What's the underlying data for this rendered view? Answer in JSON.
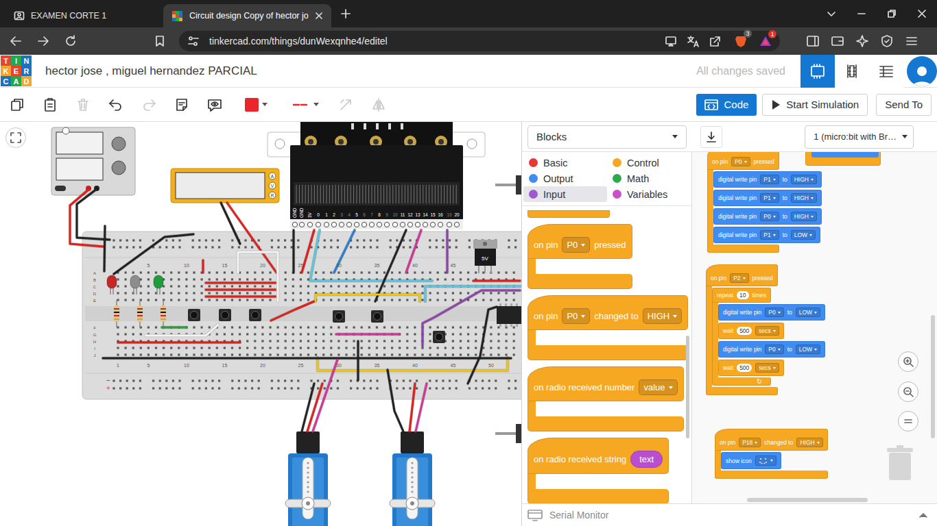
{
  "browser": {
    "tabs": [
      {
        "label": "EXAMEN CORTE 1",
        "selected": false
      },
      {
        "label": "Circuit design Copy of hector jo",
        "selected": true
      }
    ],
    "url": "tinkercad.com/things/dunWexqnhe4/editel",
    "badges": [
      "3",
      "1"
    ]
  },
  "app": {
    "logo": [
      {
        "letter": "T",
        "color": "#e8442c"
      },
      {
        "letter": "I",
        "color": "#1eaa4f"
      },
      {
        "letter": "N",
        "color": "#1b72c0"
      },
      {
        "letter": "K",
        "color": "#f0a72a"
      },
      {
        "letter": "E",
        "color": "#e8442c"
      },
      {
        "letter": "R",
        "color": "#1b72c0"
      },
      {
        "letter": "C",
        "color": "#1b72c0"
      },
      {
        "letter": "A",
        "color": "#1eaa4f"
      },
      {
        "letter": "D",
        "color": "#f0a72a"
      }
    ],
    "title": "hector jose , miguel hernandez PARCIAL",
    "save_status": "All changes saved",
    "views": [
      {
        "kind": "circuit",
        "selected": true
      },
      {
        "kind": "schematic",
        "selected": false
      },
      {
        "kind": "list",
        "selected": false
      }
    ]
  },
  "toolbar": {
    "tools": [
      {
        "kind": "copy",
        "disabled": false
      },
      {
        "kind": "paste",
        "disabled": false
      },
      {
        "kind": "delete",
        "disabled": true
      },
      {
        "kind": "undo",
        "disabled": false
      },
      {
        "kind": "redo",
        "disabled": true
      },
      {
        "kind": "note",
        "disabled": false
      },
      {
        "kind": "notes-visibility",
        "disabled": false
      },
      {
        "kind": "fill-color",
        "disabled": false,
        "color": "#e8262b"
      },
      {
        "kind": "line-style",
        "disabled": false,
        "color": "#e8262b"
      },
      {
        "kind": "rotate",
        "disabled": true
      },
      {
        "kind": "mirror",
        "disabled": true
      }
    ],
    "code_button": {
      "label": "Code",
      "selected": true
    },
    "simulate": "Start Simulation",
    "send_to": "Send To"
  },
  "code": {
    "editor_mode": "Blocks",
    "device": "1 (micro:bit with Br…",
    "categories": [
      {
        "label": "Basic",
        "color": "#e53935",
        "selected": false
      },
      {
        "label": "Control",
        "color": "#f5a623",
        "selected": false
      },
      {
        "label": "Output",
        "color": "#3f8df3",
        "selected": false
      },
      {
        "label": "Math",
        "color": "#2faa4a",
        "selected": false
      },
      {
        "label": "Input",
        "color": "#9a5cd0",
        "selected": true
      },
      {
        "label": "Variables",
        "color": "#c94fc8",
        "selected": false
      }
    ],
    "palette": [
      {
        "kind": "fragment",
        "color": "#f7a823"
      },
      {
        "kind": "hat",
        "color": "#f7a823",
        "parts": [
          {
            "kind": "label",
            "text": "on pin"
          },
          {
            "kind": "dropdown",
            "text": "P0"
          },
          {
            "kind": "label",
            "text": "pressed"
          }
        ],
        "body": []
      },
      {
        "kind": "hat",
        "color": "#f7a823",
        "parts": [
          {
            "kind": "label",
            "text": "on pin"
          },
          {
            "kind": "dropdown",
            "text": "P0"
          },
          {
            "kind": "label",
            "text": "changed to"
          },
          {
            "kind": "dropdown",
            "text": "HIGH"
          }
        ],
        "body": []
      },
      {
        "kind": "hat",
        "color": "#f7a823",
        "parts": [
          {
            "kind": "label",
            "text": "on radio received number"
          },
          {
            "kind": "dropdown",
            "text": "value"
          }
        ],
        "body": []
      },
      {
        "kind": "hat",
        "color": "#f7a823",
        "parts": [
          {
            "kind": "label",
            "text": "on radio received string"
          },
          {
            "kind": "reporter",
            "text": "text",
            "color": "#b94fd0"
          }
        ],
        "body": []
      },
      {
        "kind": "fragment",
        "color": "#f7a823"
      }
    ],
    "scripts": [
      {
        "kind": "hat",
        "color": "#f7a823",
        "parts": [
          {
            "kind": "label",
            "text": "on pin"
          },
          {
            "kind": "dropdown",
            "text": "P0"
          },
          {
            "kind": "label",
            "text": "pressed"
          }
        ],
        "body": [
          {
            "kind": "statement",
            "color": "#3f8df3",
            "parts": [
              {
                "kind": "label",
                "text": "digital write pin"
              },
              {
                "kind": "dropdown",
                "text": "P1"
              },
              {
                "kind": "label",
                "text": "to"
              },
              {
                "kind": "dropdown",
                "text": "HIGH"
              }
            ]
          },
          {
            "kind": "statement",
            "color": "#3f8df3",
            "parts": [
              {
                "kind": "label",
                "text": "digital write pin"
              },
              {
                "kind": "dropdown",
                "text": "P1"
              },
              {
                "kind": "label",
                "text": "to"
              },
              {
                "kind": "dropdown",
                "text": "HIGH"
              }
            ]
          },
          {
            "kind": "statement",
            "color": "#3f8df3",
            "parts": [
              {
                "kind": "label",
                "text": "digital write pin"
              },
              {
                "kind": "dropdown",
                "text": "P0"
              },
              {
                "kind": "label",
                "text": "to"
              },
              {
                "kind": "dropdown",
                "text": "HIGH"
              }
            ]
          },
          {
            "kind": "statement",
            "color": "#3f8df3",
            "parts": [
              {
                "kind": "label",
                "text": "digital write pin"
              },
              {
                "kind": "dropdown",
                "text": "P1"
              },
              {
                "kind": "label",
                "text": "to"
              },
              {
                "kind": "dropdown",
                "text": "LOW"
              }
            ]
          }
        ]
      },
      {
        "kind": "hat",
        "color": "#f7a823",
        "parts": [
          {
            "kind": "label",
            "text": "on pin"
          },
          {
            "kind": "dropdown",
            "text": "P2"
          },
          {
            "kind": "label",
            "text": "pressed"
          }
        ],
        "body": [
          {
            "kind": "loop",
            "color": "#f7a823",
            "parts": [
              {
                "kind": "label",
                "text": "repeat"
              },
              {
                "kind": "number",
                "text": "10"
              },
              {
                "kind": "label",
                "text": "times"
              }
            ],
            "footer": "↻",
            "body": [
              {
                "kind": "statement",
                "color": "#3f8df3",
                "parts": [
                  {
                    "kind": "label",
                    "text": "digital write pin"
                  },
                  {
                    "kind": "dropdown",
                    "text": "P0"
                  },
                  {
                    "kind": "label",
                    "text": "to"
                  },
                  {
                    "kind": "dropdown",
                    "text": "LOW"
                  }
                ]
              },
              {
                "kind": "statement",
                "color": "#f7a823",
                "parts": [
                  {
                    "kind": "label",
                    "text": "wait"
                  },
                  {
                    "kind": "number",
                    "text": "500"
                  },
                  {
                    "kind": "dropdown",
                    "text": "secs"
                  }
                ]
              },
              {
                "kind": "statement",
                "color": "#3f8df3",
                "parts": [
                  {
                    "kind": "label",
                    "text": "digital write pin"
                  },
                  {
                    "kind": "dropdown",
                    "text": "P0"
                  },
                  {
                    "kind": "label",
                    "text": "to"
                  },
                  {
                    "kind": "dropdown",
                    "text": "LOW"
                  }
                ]
              },
              {
                "kind": "statement",
                "color": "#f7a823",
                "parts": [
                  {
                    "kind": "label",
                    "text": "wait"
                  },
                  {
                    "kind": "number",
                    "text": "500"
                  },
                  {
                    "kind": "dropdown",
                    "text": "secs"
                  }
                ]
              }
            ]
          }
        ]
      },
      {
        "kind": "hat",
        "color": "#f7a823",
        "parts": [
          {
            "kind": "label",
            "text": "on pin"
          },
          {
            "kind": "dropdown",
            "text": "P18"
          },
          {
            "kind": "label",
            "text": "changed to"
          },
          {
            "kind": "dropdown",
            "text": "HIGH"
          }
        ],
        "body": [
          {
            "kind": "statement",
            "color": "#3f8df3",
            "parts": [
              {
                "kind": "label",
                "text": "show icon"
              },
              {
                "kind": "icon-dropdown"
              }
            ]
          }
        ]
      },
      {
        "kind": "fragment",
        "color": "#f7a823",
        "inner_color": "#3f8df3"
      }
    ],
    "serial_monitor": "Serial Monitor"
  },
  "circuit": {
    "multimeter": {
      "terminals": [
        "A",
        "V",
        "R"
      ]
    },
    "microbit": {
      "pins": [
        {
          "label": "GND",
          "dim": false
        },
        {
          "label": "GND",
          "dim": false
        },
        {
          "label": "3V",
          "dim": false
        },
        {
          "label": "0",
          "dim": false
        },
        {
          "label": "1",
          "dim": false
        },
        {
          "label": "2",
          "dim": false
        },
        {
          "label": "3",
          "dim": true
        },
        {
          "label": "4",
          "dim": true
        },
        {
          "label": "5",
          "dim": false
        },
        {
          "label": "6",
          "dim": true
        },
        {
          "label": "7",
          "dim": true
        },
        {
          "label": "8",
          "dim": false
        },
        {
          "label": "9",
          "dim": true
        },
        {
          "label": "10",
          "dim": true
        },
        {
          "label": "11",
          "dim": false
        },
        {
          "label": "12",
          "dim": false
        },
        {
          "label": "13",
          "dim": false
        },
        {
          "label": "14",
          "dim": false
        },
        {
          "label": "15",
          "dim": false
        },
        {
          "label": "16",
          "dim": false
        },
        {
          "label": "19",
          "dim": true
        },
        {
          "label": "20",
          "dim": false
        }
      ]
    },
    "regulator": {
      "label": "5V"
    },
    "breadboard": {
      "columns_top": [
        "5",
        "10",
        "15",
        "20",
        "25",
        "30",
        "35",
        "40",
        "45"
      ],
      "columns_bottom": [
        "1",
        "5",
        "10",
        "15",
        "20",
        "25",
        "30",
        "35",
        "40",
        "45",
        "50"
      ],
      "rows": [
        "A",
        "B",
        "C",
        "D",
        "E",
        "F",
        "G",
        "H",
        "I",
        "J"
      ],
      "rail_signs": [
        "−",
        "+"
      ]
    },
    "leds": [
      {
        "color": "#c62828"
      },
      {
        "color": "#8d8d8d"
      },
      {
        "color": "#1e9e3a"
      }
    ],
    "wires": [
      {
        "color": "#e0201b"
      },
      {
        "color": "#222222"
      },
      {
        "color": "#222222"
      },
      {
        "color": "#222222"
      },
      {
        "color": "#222222"
      },
      {
        "color": "#e0201b"
      },
      {
        "color": "#e0201b"
      },
      {
        "color": "#e0201b"
      },
      {
        "color": "#e0201b"
      },
      {
        "color": "#e0201b"
      },
      {
        "color": "#f4f4f4"
      },
      {
        "color": "#f4f4f4"
      },
      {
        "color": "#e0201b"
      },
      {
        "color": "#2e9e3a"
      },
      {
        "color": "#e0201b"
      },
      {
        "color": "#e0201b"
      },
      {
        "color": "#222222"
      },
      {
        "color": "#5cc6e0"
      },
      {
        "color": "#2a7fd4"
      },
      {
        "color": "#222222"
      },
      {
        "color": "#d1369b"
      },
      {
        "color": "#8e44ad"
      },
      {
        "color": "#f2c713"
      },
      {
        "color": "#f2c713"
      },
      {
        "color": "#d1369b"
      },
      {
        "color": "#8e44ad"
      },
      {
        "color": "#5cc6e0"
      },
      {
        "color": "#e0201b"
      },
      {
        "color": "#222222"
      },
      {
        "color": "#222222"
      },
      {
        "color": "#222222"
      },
      {
        "color": "#222222"
      },
      {
        "color": "#e0201b"
      },
      {
        "color": "#d1369b"
      },
      {
        "color": "#222222"
      },
      {
        "color": "#e0201b"
      },
      {
        "color": "#d1369b"
      }
    ]
  }
}
